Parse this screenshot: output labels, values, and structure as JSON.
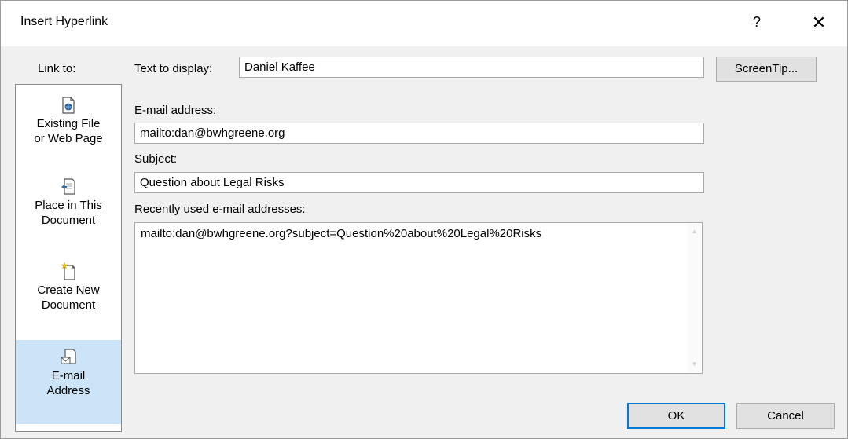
{
  "dialog": {
    "title": "Insert Hyperlink",
    "help_label": "?",
    "close_label": "✕"
  },
  "linkto": {
    "label": "Link to:",
    "items": [
      {
        "line1": "Existing File",
        "line2": "or Web Page",
        "icon": "existing-file-icon"
      },
      {
        "line1": "Place in This",
        "line2": "Document",
        "icon": "place-in-document-icon"
      },
      {
        "line1": "Create New",
        "line2": "Document",
        "icon": "create-new-document-icon"
      },
      {
        "line1": "E-mail",
        "line2": "Address",
        "icon": "email-address-icon",
        "selected": true
      }
    ]
  },
  "form": {
    "text_to_display_label": "Text to display:",
    "text_to_display_value": "Daniel Kaffee",
    "screentip_label": "ScreenTip...",
    "email_label": "E-mail address:",
    "email_value": "mailto:dan@bwhgreene.org",
    "subject_label": "Subject:",
    "subject_value": "Question about Legal Risks",
    "recent_label": "Recently used e-mail addresses:",
    "recent_items": [
      "mailto:dan@bwhgreene.org?subject=Question%20about%20Legal%20Risks"
    ]
  },
  "buttons": {
    "ok_label": "OK",
    "cancel_label": "Cancel"
  },
  "colors": {
    "selected_item_bg": "#cce4f7",
    "default_button_border": "#0078d7"
  }
}
